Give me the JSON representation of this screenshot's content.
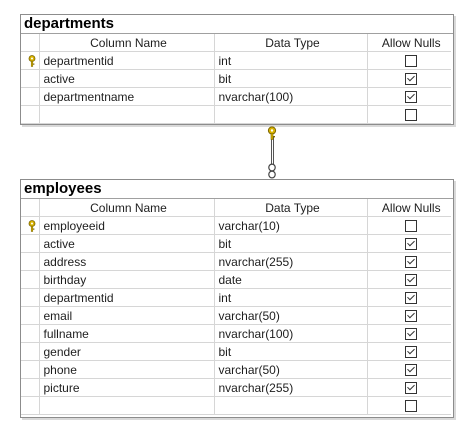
{
  "headers": {
    "column_name": "Column Name",
    "data_type": "Data Type",
    "allow_nulls": "Allow Nulls"
  },
  "tables": [
    {
      "name": "departments",
      "columns": [
        {
          "name": "departmentid",
          "type": "int",
          "allow_nulls": false,
          "primary_key": true
        },
        {
          "name": "active",
          "type": "bit",
          "allow_nulls": true,
          "primary_key": false
        },
        {
          "name": "departmentname",
          "type": "nvarchar(100)",
          "allow_nulls": true,
          "primary_key": false
        },
        {
          "name": "",
          "type": "",
          "allow_nulls": false,
          "primary_key": false
        }
      ]
    },
    {
      "name": "employees",
      "columns": [
        {
          "name": "employeeid",
          "type": "varchar(10)",
          "allow_nulls": false,
          "primary_key": true
        },
        {
          "name": "active",
          "type": "bit",
          "allow_nulls": true,
          "primary_key": false
        },
        {
          "name": "address",
          "type": "nvarchar(255)",
          "allow_nulls": true,
          "primary_key": false
        },
        {
          "name": "birthday",
          "type": "date",
          "allow_nulls": true,
          "primary_key": false
        },
        {
          "name": "departmentid",
          "type": "int",
          "allow_nulls": true,
          "primary_key": false
        },
        {
          "name": "email",
          "type": "varchar(50)",
          "allow_nulls": true,
          "primary_key": false
        },
        {
          "name": "fullname",
          "type": "nvarchar(100)",
          "allow_nulls": true,
          "primary_key": false
        },
        {
          "name": "gender",
          "type": "bit",
          "allow_nulls": true,
          "primary_key": false
        },
        {
          "name": "phone",
          "type": "varchar(50)",
          "allow_nulls": true,
          "primary_key": false
        },
        {
          "name": "picture",
          "type": "nvarchar(255)",
          "allow_nulls": true,
          "primary_key": false
        },
        {
          "name": "",
          "type": "",
          "allow_nulls": false,
          "primary_key": false
        }
      ]
    }
  ],
  "relationship": {
    "from": "departments",
    "to": "employees",
    "one_end_icon": "key-icon",
    "many_end_icon": "infinity-icon"
  },
  "colors": {
    "key": "#d9b300",
    "border": "#8c8c8c",
    "grid": "#d6d6d6"
  }
}
